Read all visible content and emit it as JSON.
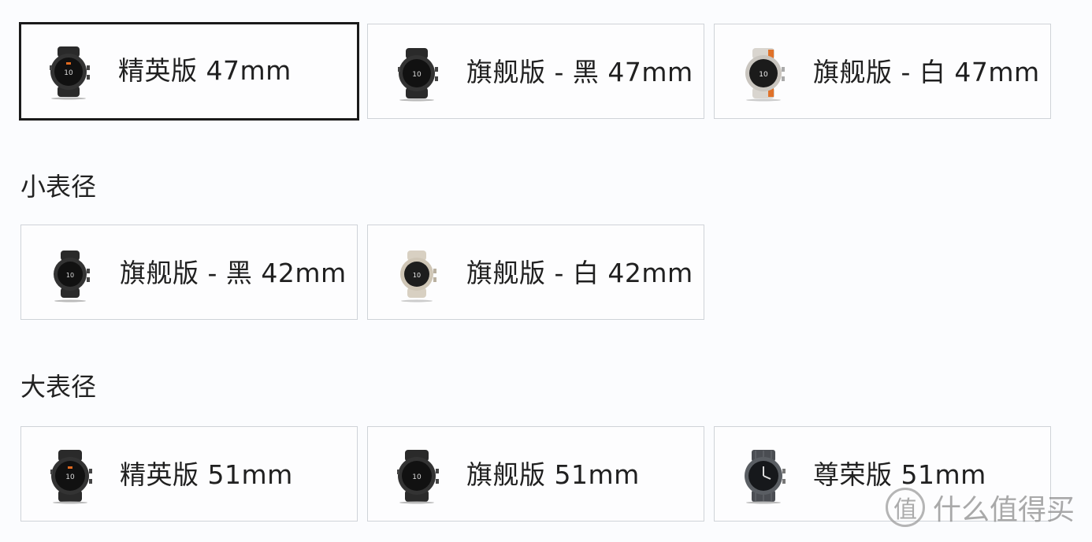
{
  "groups": [
    {
      "title": "",
      "options": [
        {
          "label": "精英版 47mm",
          "selected": true,
          "variant": "dark-orange",
          "icon": "watch-dark-icon"
        },
        {
          "label": "旗舰版 - 黑 47mm",
          "selected": false,
          "variant": "dark",
          "icon": "watch-dark-icon"
        },
        {
          "label": "旗舰版 - 白 47mm",
          "selected": false,
          "variant": "white-orange",
          "icon": "watch-white-orange-icon"
        }
      ]
    },
    {
      "title": "小表径",
      "options": [
        {
          "label": "旗舰版 - 黑 42mm",
          "selected": false,
          "variant": "dark",
          "icon": "watch-dark-icon"
        },
        {
          "label": "旗舰版 - 白 42mm",
          "selected": false,
          "variant": "cream",
          "icon": "watch-cream-icon"
        }
      ]
    },
    {
      "title": "大表径",
      "options": [
        {
          "label": "精英版 51mm",
          "selected": false,
          "variant": "dark-orange",
          "icon": "watch-dark-icon"
        },
        {
          "label": "旗舰版 51mm",
          "selected": false,
          "variant": "dark",
          "icon": "watch-dark-icon"
        },
        {
          "label": "尊荣版 51mm",
          "selected": false,
          "variant": "metal",
          "icon": "watch-metal-icon"
        }
      ]
    }
  ],
  "watermark": {
    "badge": "值",
    "text": "什么值得买"
  },
  "colors": {
    "selected_border": "#1a1a1a",
    "card_border": "#cfd3d8",
    "background": "#fbfcfe"
  }
}
